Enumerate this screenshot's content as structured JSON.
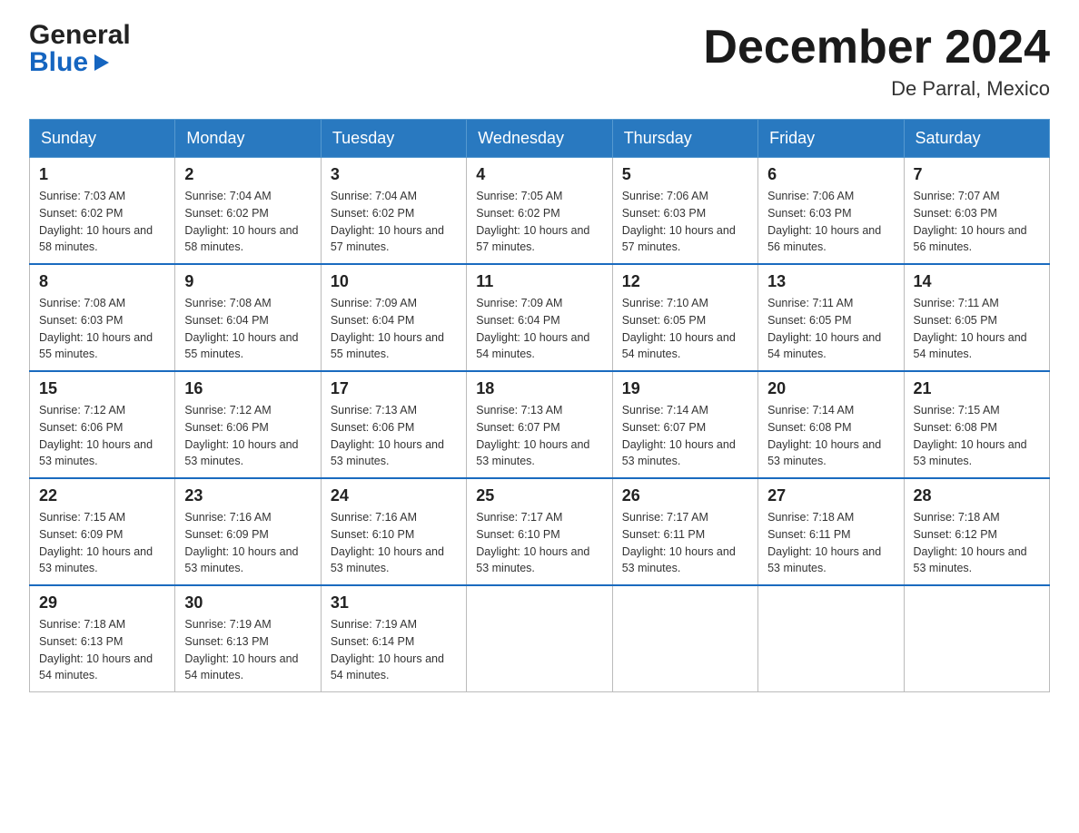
{
  "header": {
    "logo_general": "General",
    "logo_blue": "Blue",
    "month_title": "December 2024",
    "location": "De Parral, Mexico"
  },
  "days_of_week": [
    "Sunday",
    "Monday",
    "Tuesday",
    "Wednesday",
    "Thursday",
    "Friday",
    "Saturday"
  ],
  "weeks": [
    [
      {
        "day": "1",
        "sunrise": "7:03 AM",
        "sunset": "6:02 PM",
        "daylight": "10 hours and 58 minutes."
      },
      {
        "day": "2",
        "sunrise": "7:04 AM",
        "sunset": "6:02 PM",
        "daylight": "10 hours and 58 minutes."
      },
      {
        "day": "3",
        "sunrise": "7:04 AM",
        "sunset": "6:02 PM",
        "daylight": "10 hours and 57 minutes."
      },
      {
        "day": "4",
        "sunrise": "7:05 AM",
        "sunset": "6:02 PM",
        "daylight": "10 hours and 57 minutes."
      },
      {
        "day": "5",
        "sunrise": "7:06 AM",
        "sunset": "6:03 PM",
        "daylight": "10 hours and 57 minutes."
      },
      {
        "day": "6",
        "sunrise": "7:06 AM",
        "sunset": "6:03 PM",
        "daylight": "10 hours and 56 minutes."
      },
      {
        "day": "7",
        "sunrise": "7:07 AM",
        "sunset": "6:03 PM",
        "daylight": "10 hours and 56 minutes."
      }
    ],
    [
      {
        "day": "8",
        "sunrise": "7:08 AM",
        "sunset": "6:03 PM",
        "daylight": "10 hours and 55 minutes."
      },
      {
        "day": "9",
        "sunrise": "7:08 AM",
        "sunset": "6:04 PM",
        "daylight": "10 hours and 55 minutes."
      },
      {
        "day": "10",
        "sunrise": "7:09 AM",
        "sunset": "6:04 PM",
        "daylight": "10 hours and 55 minutes."
      },
      {
        "day": "11",
        "sunrise": "7:09 AM",
        "sunset": "6:04 PM",
        "daylight": "10 hours and 54 minutes."
      },
      {
        "day": "12",
        "sunrise": "7:10 AM",
        "sunset": "6:05 PM",
        "daylight": "10 hours and 54 minutes."
      },
      {
        "day": "13",
        "sunrise": "7:11 AM",
        "sunset": "6:05 PM",
        "daylight": "10 hours and 54 minutes."
      },
      {
        "day": "14",
        "sunrise": "7:11 AM",
        "sunset": "6:05 PM",
        "daylight": "10 hours and 54 minutes."
      }
    ],
    [
      {
        "day": "15",
        "sunrise": "7:12 AM",
        "sunset": "6:06 PM",
        "daylight": "10 hours and 53 minutes."
      },
      {
        "day": "16",
        "sunrise": "7:12 AM",
        "sunset": "6:06 PM",
        "daylight": "10 hours and 53 minutes."
      },
      {
        "day": "17",
        "sunrise": "7:13 AM",
        "sunset": "6:06 PM",
        "daylight": "10 hours and 53 minutes."
      },
      {
        "day": "18",
        "sunrise": "7:13 AM",
        "sunset": "6:07 PM",
        "daylight": "10 hours and 53 minutes."
      },
      {
        "day": "19",
        "sunrise": "7:14 AM",
        "sunset": "6:07 PM",
        "daylight": "10 hours and 53 minutes."
      },
      {
        "day": "20",
        "sunrise": "7:14 AM",
        "sunset": "6:08 PM",
        "daylight": "10 hours and 53 minutes."
      },
      {
        "day": "21",
        "sunrise": "7:15 AM",
        "sunset": "6:08 PM",
        "daylight": "10 hours and 53 minutes."
      }
    ],
    [
      {
        "day": "22",
        "sunrise": "7:15 AM",
        "sunset": "6:09 PM",
        "daylight": "10 hours and 53 minutes."
      },
      {
        "day": "23",
        "sunrise": "7:16 AM",
        "sunset": "6:09 PM",
        "daylight": "10 hours and 53 minutes."
      },
      {
        "day": "24",
        "sunrise": "7:16 AM",
        "sunset": "6:10 PM",
        "daylight": "10 hours and 53 minutes."
      },
      {
        "day": "25",
        "sunrise": "7:17 AM",
        "sunset": "6:10 PM",
        "daylight": "10 hours and 53 minutes."
      },
      {
        "day": "26",
        "sunrise": "7:17 AM",
        "sunset": "6:11 PM",
        "daylight": "10 hours and 53 minutes."
      },
      {
        "day": "27",
        "sunrise": "7:18 AM",
        "sunset": "6:11 PM",
        "daylight": "10 hours and 53 minutes."
      },
      {
        "day": "28",
        "sunrise": "7:18 AM",
        "sunset": "6:12 PM",
        "daylight": "10 hours and 53 minutes."
      }
    ],
    [
      {
        "day": "29",
        "sunrise": "7:18 AM",
        "sunset": "6:13 PM",
        "daylight": "10 hours and 54 minutes."
      },
      {
        "day": "30",
        "sunrise": "7:19 AM",
        "sunset": "6:13 PM",
        "daylight": "10 hours and 54 minutes."
      },
      {
        "day": "31",
        "sunrise": "7:19 AM",
        "sunset": "6:14 PM",
        "daylight": "10 hours and 54 minutes."
      },
      null,
      null,
      null,
      null
    ]
  ],
  "labels": {
    "sunrise": "Sunrise:",
    "sunset": "Sunset:",
    "daylight": "Daylight:"
  }
}
